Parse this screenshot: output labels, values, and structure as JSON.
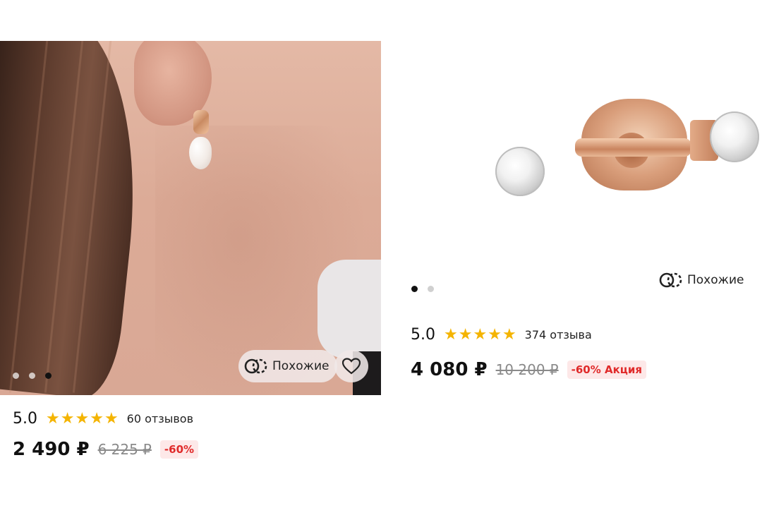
{
  "products": [
    {
      "image_dots": 3,
      "active_dot": 2,
      "similar_label": "Похожие",
      "rating": "5.0",
      "stars": 5,
      "reviews": "60 отзывов",
      "price": "2 490 ₽",
      "old_price": "6 225 ₽",
      "discount_badge": "-60%"
    },
    {
      "image_dots": 2,
      "active_dot": 0,
      "similar_label": "Похожие",
      "rating": "5.0",
      "stars": 5,
      "reviews": "374 отзыва",
      "price": "4 080 ₽",
      "old_price": "10 200 ₽",
      "discount_badge": "-60% Акция"
    }
  ],
  "colors": {
    "star": "#f4b400",
    "discount_text": "#e02a2a",
    "discount_bg": "#fde8e8"
  },
  "icons": {
    "similar": "similar-icon",
    "favorite": "heart-icon",
    "star": "star-icon"
  }
}
